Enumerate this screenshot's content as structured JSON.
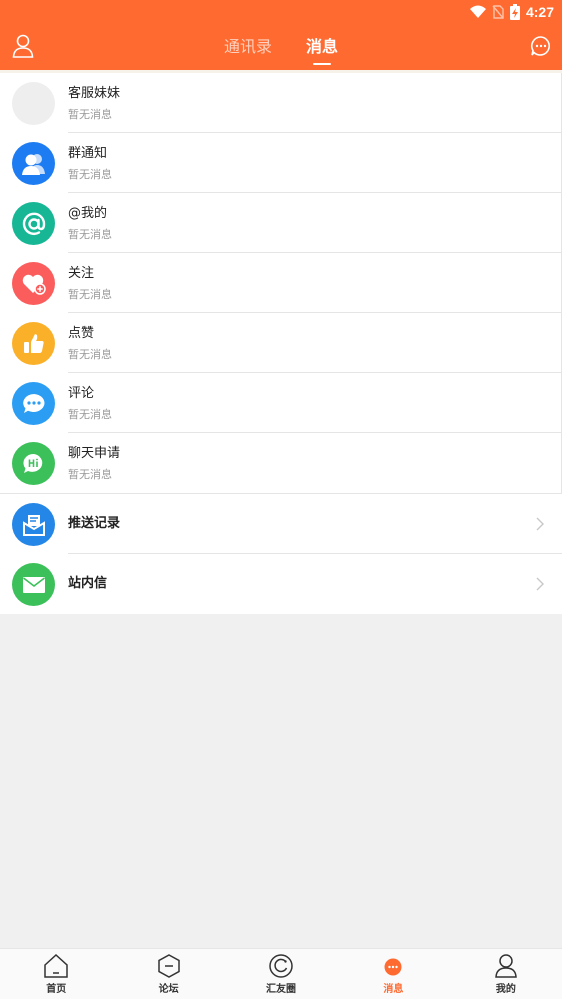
{
  "status": {
    "time": "4:27"
  },
  "header": {
    "tabs": [
      {
        "label": "通讯录",
        "active": false
      },
      {
        "label": "消息",
        "active": true
      }
    ],
    "accent": "#ff6a30"
  },
  "messages": [
    {
      "title": "客服妹妹",
      "subtitle": "暂无消息",
      "icon": "placeholder-avatar",
      "color": "#eeeeee"
    },
    {
      "title": "群通知",
      "subtitle": "暂无消息",
      "icon": "group-icon",
      "color": "#1e7cf2"
    },
    {
      "title": "@我的",
      "subtitle": "暂无消息",
      "icon": "at-icon",
      "color": "#17b796"
    },
    {
      "title": "关注",
      "subtitle": "暂无消息",
      "icon": "heart-plus-icon",
      "color": "#fb5d5d"
    },
    {
      "title": "点赞",
      "subtitle": "暂无消息",
      "icon": "thumbs-up-icon",
      "color": "#fbb02a"
    },
    {
      "title": "评论",
      "subtitle": "暂无消息",
      "icon": "comment-icon",
      "color": "#2b9ef4"
    },
    {
      "title": "聊天申请",
      "subtitle": "暂无消息",
      "icon": "hi-chat-icon",
      "color": "#3cc05a"
    }
  ],
  "nav_items": [
    {
      "title": "推送记录",
      "icon": "push-mail-icon",
      "color": "#2486e6"
    },
    {
      "title": "站内信",
      "icon": "mail-icon",
      "color": "#3cc05a"
    }
  ],
  "bottom_nav": [
    {
      "label": "首页",
      "icon": "home-icon",
      "active": false
    },
    {
      "label": "论坛",
      "icon": "forum-icon",
      "active": false
    },
    {
      "label": "汇友圈",
      "icon": "circle-icon",
      "active": false
    },
    {
      "label": "消息",
      "icon": "message-icon",
      "active": true
    },
    {
      "label": "我的",
      "icon": "profile-icon",
      "active": false
    }
  ]
}
